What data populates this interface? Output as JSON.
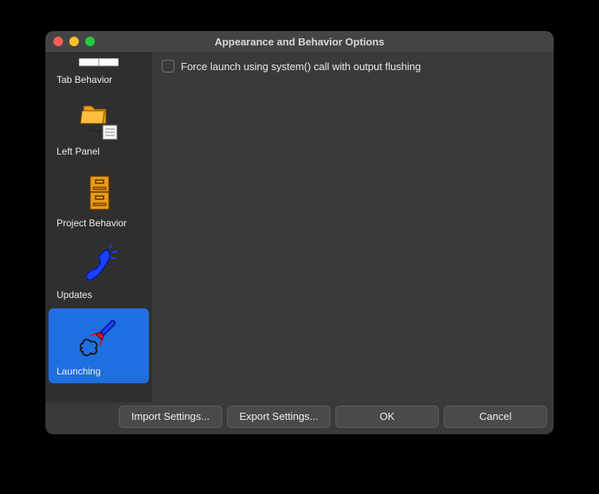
{
  "window": {
    "title": "Appearance and Behavior Options"
  },
  "sidebar": {
    "items": [
      {
        "label": "Tab Behavior"
      },
      {
        "label": "Left Panel"
      },
      {
        "label": "Project Behavior"
      },
      {
        "label": "Updates"
      },
      {
        "label": "Launching"
      }
    ],
    "selected_index": 4
  },
  "content": {
    "force_launch_checkbox": {
      "checked": false,
      "label": "Force launch using system() call with output flushing"
    }
  },
  "footer": {
    "import_label": "Import Settings...",
    "export_label": "Export Settings...",
    "ok_label": "OK",
    "cancel_label": "Cancel"
  }
}
